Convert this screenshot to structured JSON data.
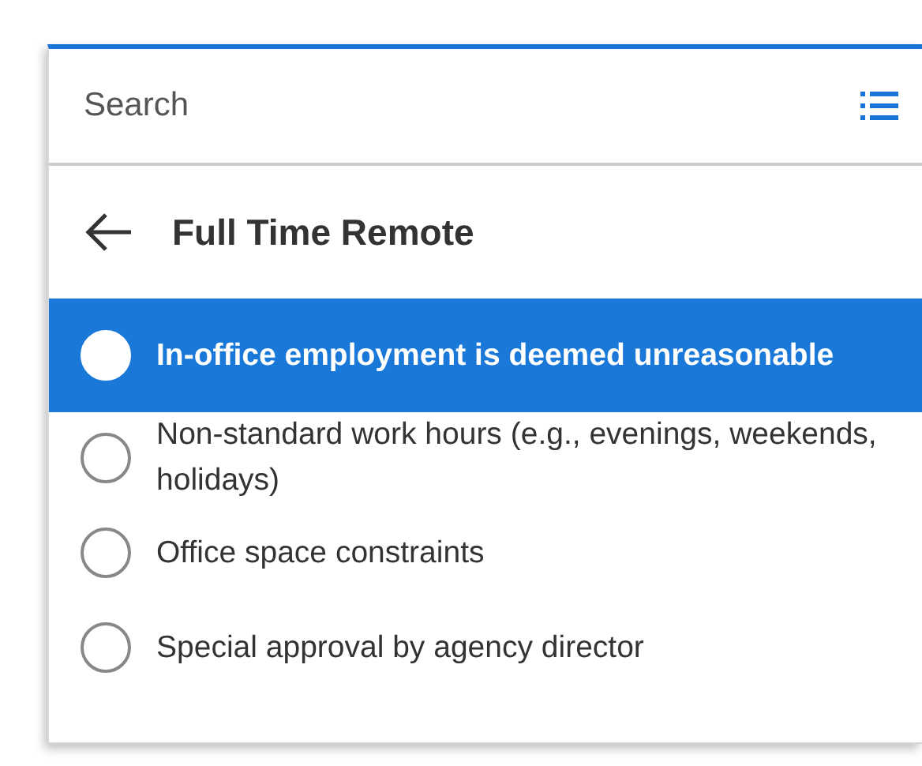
{
  "search": {
    "placeholder": "Search"
  },
  "header": {
    "title": "Full Time Remote"
  },
  "options": [
    {
      "label": "In-office employment is deemed unreasonable",
      "selected": true
    },
    {
      "label": "Non-standard work hours (e.g., evenings, weekends, holidays)",
      "selected": false
    },
    {
      "label": "Office space constraints",
      "selected": false
    },
    {
      "label": "Special approval by agency director",
      "selected": false
    }
  ]
}
